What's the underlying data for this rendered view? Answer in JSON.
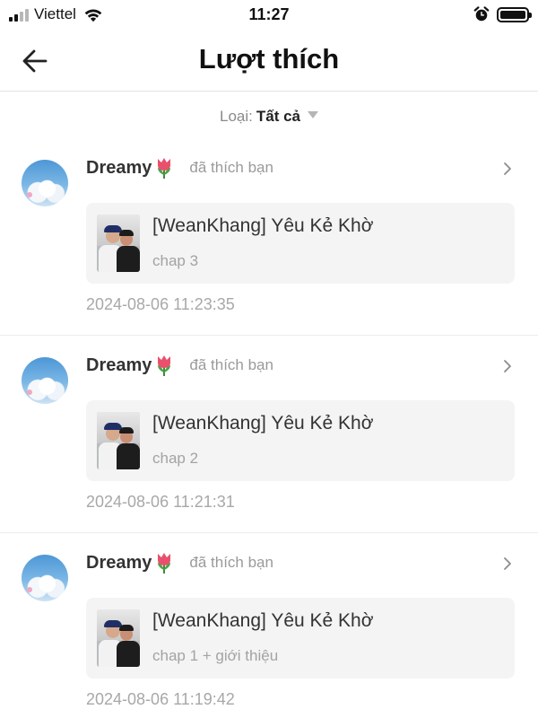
{
  "status_bar": {
    "carrier": "Viettel",
    "time": "11:27",
    "icons": [
      "signal-icon",
      "wifi-icon",
      "alarm-icon",
      "battery-icon"
    ]
  },
  "header": {
    "title": "Lượt thích",
    "back_icon": "arrow-left-icon"
  },
  "filter": {
    "label": "Loại:",
    "value": "Tất cả"
  },
  "likes": [
    {
      "username": "Dreamy",
      "emoji": "tulip",
      "action": "đã thích bạn",
      "comic_title": "[WeanKhang] Yêu Kẻ Khờ",
      "chapter": "chap 3",
      "timestamp": "2024-08-06 11:23:35"
    },
    {
      "username": "Dreamy",
      "emoji": "tulip",
      "action": "đã thích bạn",
      "comic_title": "[WeanKhang] Yêu Kẻ Khờ",
      "chapter": "chap 2",
      "timestamp": "2024-08-06 11:21:31"
    },
    {
      "username": "Dreamy",
      "emoji": "tulip",
      "action": "đã thích bạn",
      "comic_title": "[WeanKhang] Yêu Kẻ Khờ",
      "chapter": "chap 1 + giới thiệu",
      "timestamp": "2024-08-06 11:19:42"
    }
  ],
  "colors": {
    "card_background": "#f4f4f4",
    "muted_text": "#9a9a9a",
    "divider": "#e3e3e3"
  }
}
